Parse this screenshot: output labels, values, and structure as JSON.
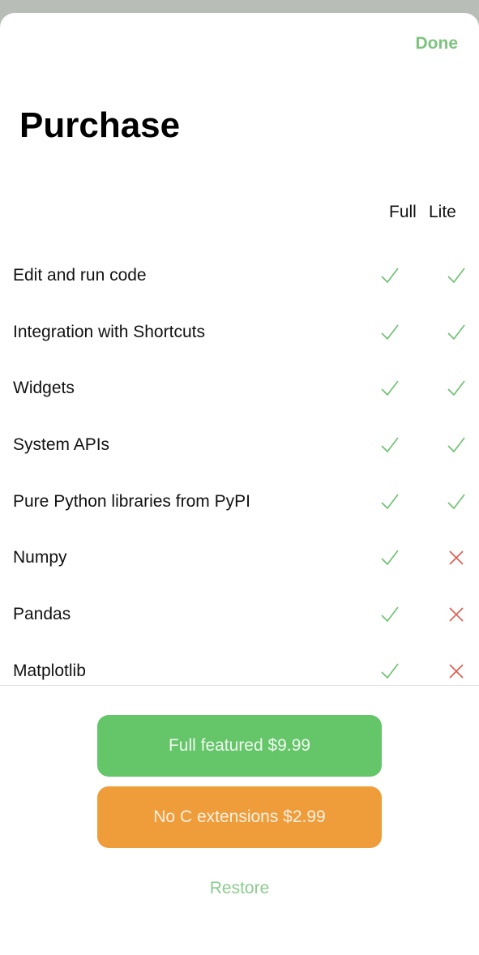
{
  "header": {
    "done_label": "Done",
    "title": "Purchase"
  },
  "columns": {
    "full": "Full",
    "lite": "Lite"
  },
  "colors": {
    "check": "#6cc06f",
    "cross": "#e05a4e",
    "accent": "#7cc47e",
    "full_button": "#64c569",
    "lite_button": "#ef9c3a"
  },
  "features": [
    {
      "label": "Edit and run code",
      "full": "check-icon",
      "lite": "check-icon"
    },
    {
      "label": "Integration with Shortcuts",
      "full": "check-icon",
      "lite": "check-icon"
    },
    {
      "label": "Widgets",
      "full": "check-icon",
      "lite": "check-icon"
    },
    {
      "label": "System APIs",
      "full": "check-icon",
      "lite": "check-icon"
    },
    {
      "label": "Pure Python libraries from PyPI",
      "full": "check-icon",
      "lite": "check-icon"
    },
    {
      "label": "Numpy",
      "full": "check-icon",
      "lite": "cross-icon"
    },
    {
      "label": "Pandas",
      "full": "check-icon",
      "lite": "cross-icon"
    },
    {
      "label": "Matplotlib",
      "full": "check-icon",
      "lite": "cross-icon"
    }
  ],
  "buttons": {
    "full_label": "Full featured $9.99",
    "lite_label": "No C extensions $2.99",
    "restore_label": "Restore"
  }
}
